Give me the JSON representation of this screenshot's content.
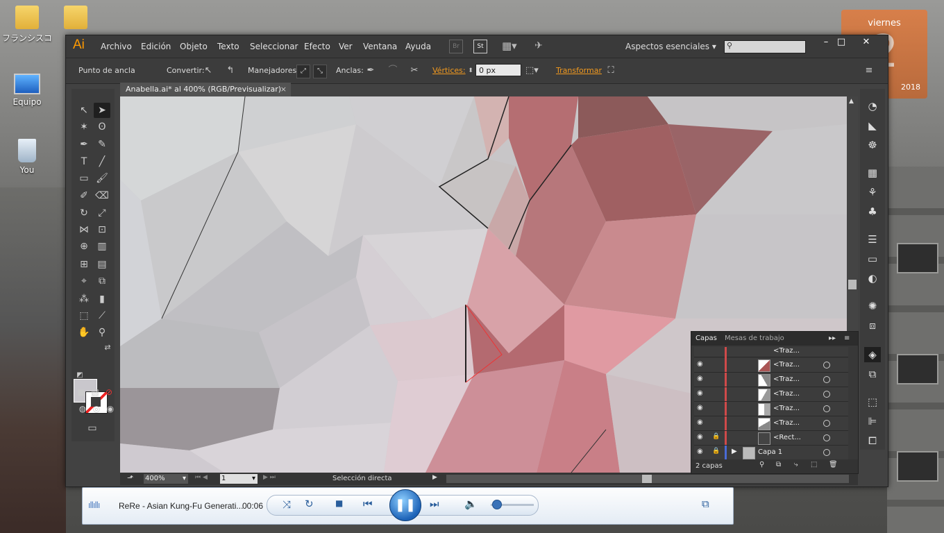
{
  "desktop": {
    "icons": [
      {
        "label": "フランシスコ",
        "icon": "user-folder-icon"
      },
      {
        "label": "Equipo",
        "icon": "computer-icon"
      },
      {
        "label": "You",
        "icon": "recycle-bin-icon"
      }
    ],
    "folder2_icon": "folder-icon",
    "calendar": {
      "weekday": "viernes",
      "day": "2",
      "year": "2018"
    }
  },
  "app": {
    "logo": "Ai",
    "menu": [
      "Archivo",
      "Edición",
      "Objeto",
      "Texto",
      "Seleccionar",
      "Efecto",
      "Ver",
      "Ventana",
      "Ayuda"
    ],
    "menubar_icons": {
      "br": "Br",
      "st": "St"
    },
    "workspace": "Aspectos esenciales",
    "search_placeholder": "",
    "window_buttons": {
      "minimize": "–",
      "maximize": "□",
      "close": "✕"
    }
  },
  "control_bar": {
    "anchor_label": "Punto de ancla",
    "convert_label": "Convertir:",
    "handles_label": "Manejadores:",
    "anchors_label": "Anclas:",
    "vertices_label": "Vértices:",
    "vertices_value": "0 px",
    "transform_label": "Transformar"
  },
  "document": {
    "tab_title": "Anabella.ai* al 400% (RGB/Previsualizar)",
    "tab_close": "×",
    "zoom": "400%",
    "artboard": "1",
    "status_text": "Selección directa"
  },
  "layers_panel": {
    "tabs": [
      "Capas",
      "Mesas de trabajo"
    ],
    "rows": [
      {
        "name": "<Traz...",
        "locked": false,
        "thumb": "triangle"
      },
      {
        "name": "<Traz...",
        "locked": false,
        "thumb": "triangle"
      },
      {
        "name": "<Traz...",
        "locked": false,
        "thumb": "triangle"
      },
      {
        "name": "<Traz...",
        "locked": false,
        "thumb": "triangle"
      },
      {
        "name": "<Traz...",
        "locked": false,
        "thumb": "triangle"
      },
      {
        "name": "<Traz...",
        "locked": false,
        "thumb": "triangle"
      },
      {
        "name": "<Rect...",
        "locked": true,
        "thumb": "rect"
      },
      {
        "name": "Capa 1",
        "locked": true,
        "thumb": "layer"
      }
    ],
    "footer_count": "2 capas"
  },
  "media_player": {
    "track": "ReRe - Asian Kung-Fu Generati...",
    "time": "00:06",
    "volume": 0.1
  },
  "colors": {
    "accent": "#f39a1e",
    "fill_swatch": "#c9c7cc",
    "layer_bar": "#d04a4a"
  }
}
